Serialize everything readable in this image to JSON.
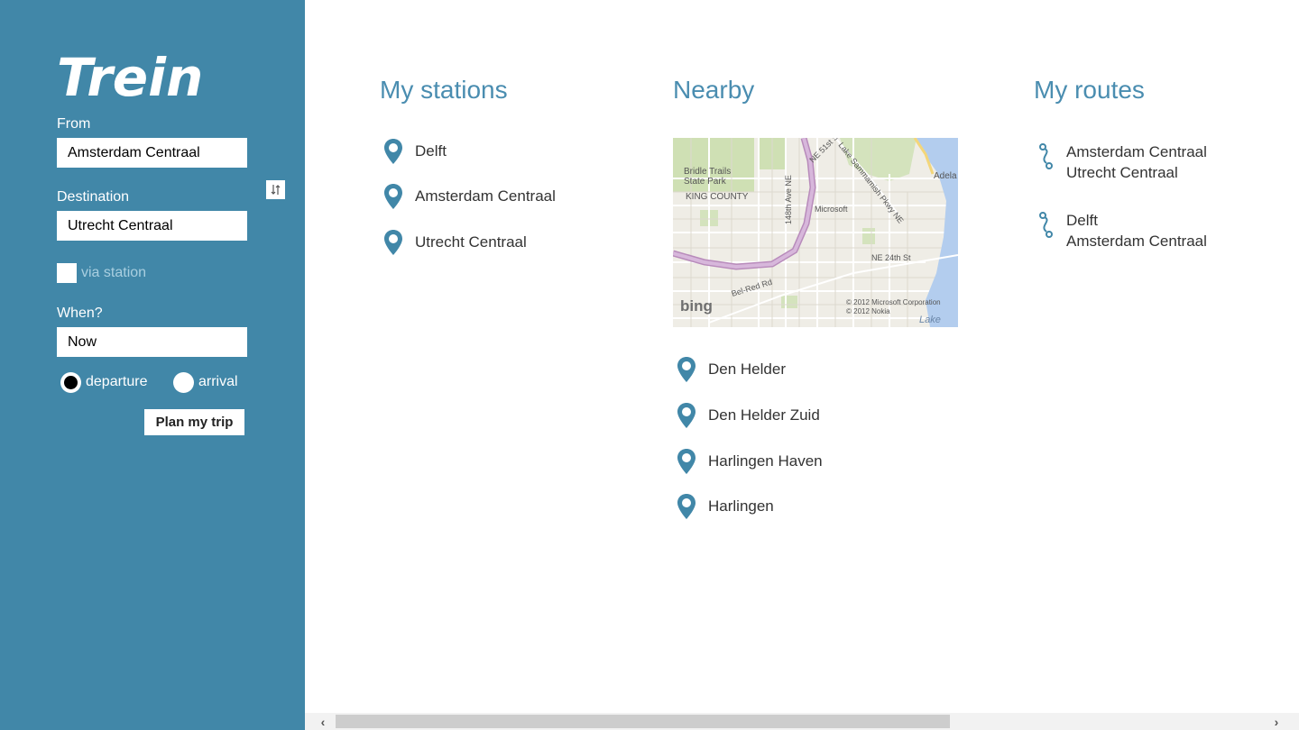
{
  "app": {
    "title": "Trein",
    "accent_color": "#4187a8"
  },
  "planner": {
    "from_label": "From",
    "from_value": "Amsterdam Centraal",
    "destination_label": "Destination",
    "destination_value": "Utrecht Centraal",
    "swap_icon": "swap-vertical-icon",
    "via_label": "via station",
    "via_checked": false,
    "when_label": "When?",
    "when_value": "Now",
    "departure_label": "departure",
    "arrival_label": "arrival",
    "selected_mode": "departure",
    "plan_button": "Plan my trip"
  },
  "my_stations": {
    "title": "My stations",
    "items": [
      {
        "label": "Delft"
      },
      {
        "label": "Amsterdam Centraal"
      },
      {
        "label": "Utrecht Centraal"
      }
    ]
  },
  "nearby": {
    "title": "Nearby",
    "map": {
      "labels": [
        "Bridle Trails",
        "State Park",
        "KING COUNTY",
        "148th Ave NE",
        "NE 51st St",
        "Lake Sammamish Pkwy NE",
        "Microsoft",
        "NE 24th St",
        "Bel-Red Rd",
        "Adela",
        "Lake"
      ],
      "copyright_1": "© 2012 Microsoft Corporation",
      "copyright_2": "© 2012 Nokia",
      "brand": "bing"
    },
    "items": [
      {
        "label": "Den Helder"
      },
      {
        "label": "Den Helder Zuid"
      },
      {
        "label": "Harlingen Haven"
      },
      {
        "label": "Harlingen"
      }
    ]
  },
  "my_routes": {
    "title": "My routes",
    "items": [
      {
        "from": "Amsterdam Centraal",
        "to": "Utrecht Centraal"
      },
      {
        "from": "Delft",
        "to": "Amsterdam Centraal"
      }
    ]
  },
  "scrollbar": {
    "left_arrow": "‹",
    "right_arrow": "›",
    "position_fraction": 0
  }
}
